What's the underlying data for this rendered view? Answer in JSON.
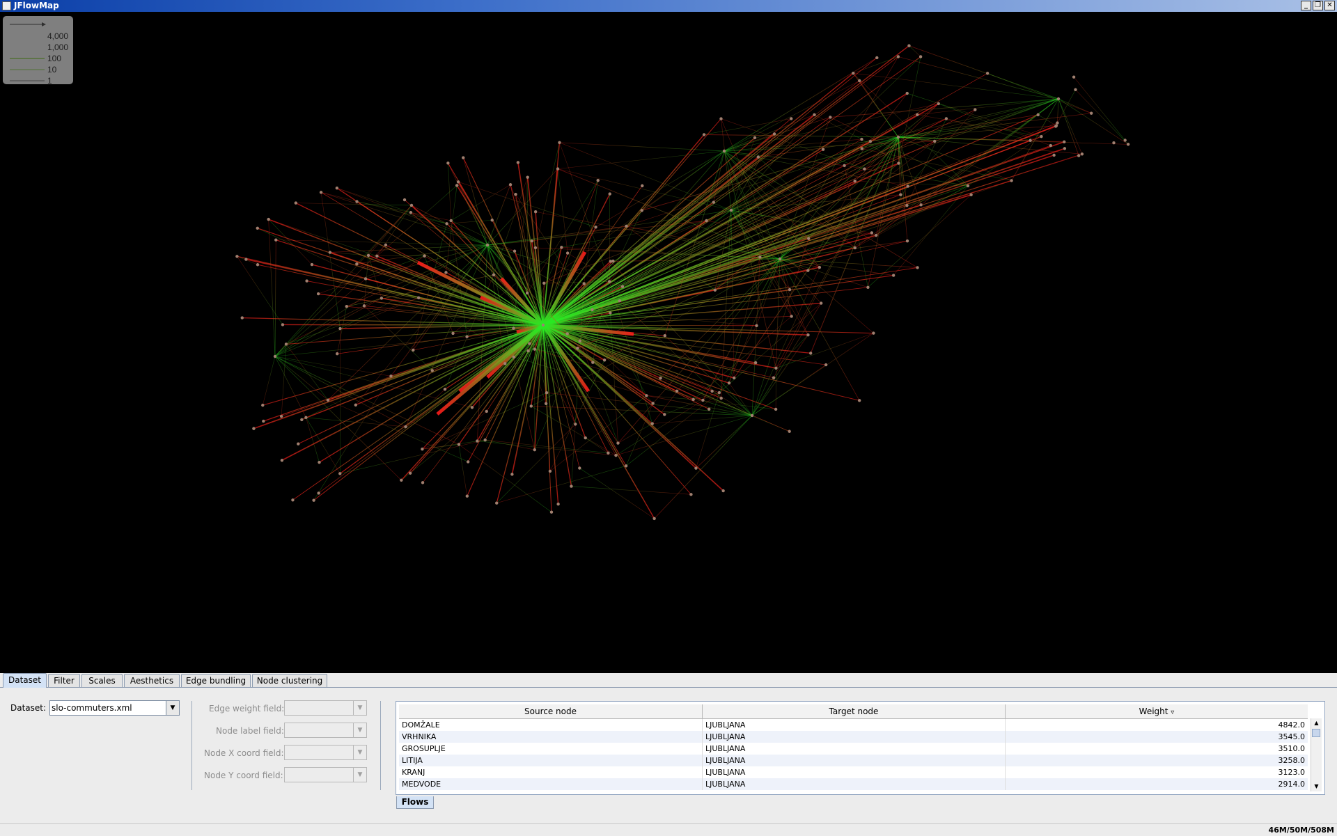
{
  "window": {
    "title": "JFlowMap",
    "minimize": "_",
    "restore": "❐",
    "close": "✕"
  },
  "legend": {
    "items": [
      {
        "label": "4,000"
      },
      {
        "label": "1,000"
      },
      {
        "label": "100"
      },
      {
        "label": "10"
      },
      {
        "label": "1"
      }
    ]
  },
  "colors": {
    "source_end": "#ff1a1a",
    "target_end": "#22ee22",
    "node": "#a08070",
    "map_bg": "#000000"
  },
  "tabs": [
    {
      "label": "Dataset",
      "active": true
    },
    {
      "label": "Filter",
      "active": false
    },
    {
      "label": "Scales",
      "active": false
    },
    {
      "label": "Aesthetics",
      "active": false
    },
    {
      "label": "Edge bundling",
      "active": false
    },
    {
      "label": "Node clustering",
      "active": false
    }
  ],
  "dataset": {
    "label": "Dataset:",
    "value": "slo-commuters.xml"
  },
  "fields": {
    "edge_weight": "Edge weight field:",
    "node_label": "Node label field:",
    "node_x": "Node X coord field:",
    "node_y": "Node Y coord field:"
  },
  "table": {
    "headers": [
      "Source node",
      "Target node",
      "Weight"
    ],
    "sort_indicator": "▿",
    "rows": [
      {
        "source": "DOMŽALE",
        "target": "LJUBLJANA",
        "weight": "4842.0"
      },
      {
        "source": "VRHNIKA",
        "target": "LJUBLJANA",
        "weight": "3545.0"
      },
      {
        "source": "GROSUPLJE",
        "target": "LJUBLJANA",
        "weight": "3510.0"
      },
      {
        "source": "LITIJA",
        "target": "LJUBLJANA",
        "weight": "3258.0"
      },
      {
        "source": "KRANJ",
        "target": "LJUBLJANA",
        "weight": "3123.0"
      },
      {
        "source": "MEDVODE",
        "target": "LJUBLJANA",
        "weight": "2914.0"
      }
    ],
    "bottom_tab": "Flows"
  },
  "status": {
    "memory": "46M/50M/508M"
  }
}
